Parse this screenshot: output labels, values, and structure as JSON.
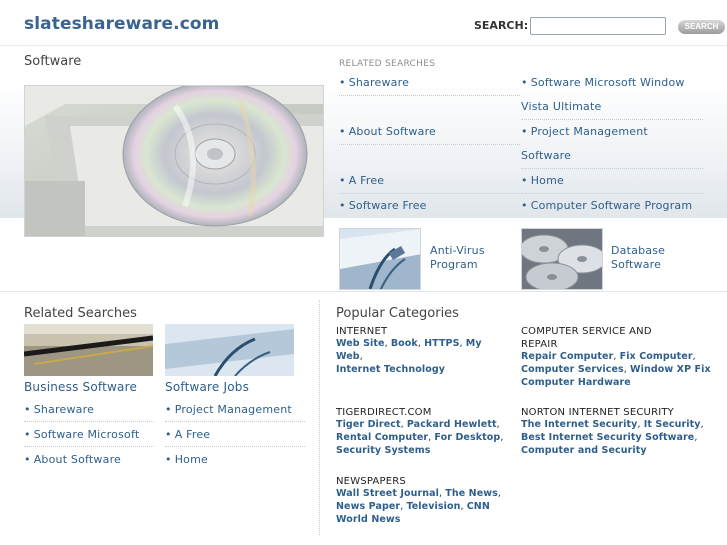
{
  "header": {
    "logo": "slateshareware.com",
    "search_label": "SEARCH:",
    "search_value": "",
    "search_button": "SEARCH"
  },
  "main": {
    "title": "Software"
  },
  "related_searches_top": {
    "title": "RELATED SEARCHES",
    "left": [
      "Shareware",
      "About Software",
      "A Free",
      "Software Free"
    ],
    "right": [
      "Software Microsoft Window Vista Ultimate",
      "Project Management Software",
      "Home",
      "Computer Software Program"
    ],
    "thumbs": [
      {
        "label_line1": "Anti-Virus",
        "label_line2": "Program"
      },
      {
        "label_line1": "Database",
        "label_line2": "Software"
      }
    ]
  },
  "related_searches_bottom": {
    "title": "Related Searches",
    "col1": {
      "heading": "Business Software",
      "links": [
        "Shareware",
        "Software Microsoft",
        "About Software"
      ]
    },
    "col2": {
      "heading": "Software Jobs",
      "links": [
        "Project Management",
        "A Free",
        "Home"
      ]
    }
  },
  "popular": {
    "title": "Popular Categories",
    "categories": [
      {
        "title": "INTERNET",
        "title_line2": "",
        "links": [
          "Web Site",
          "Book",
          "HTTPS",
          "My Web",
          "Internet Technology"
        ]
      },
      {
        "title": "COMPUTER SERVICE AND",
        "title_line2": "REPAIR",
        "links": [
          "Repair Computer",
          "Fix Computer",
          "Computer Services",
          "Window XP Fix",
          "Computer Hardware"
        ]
      },
      {
        "title": "TIGERDIRECT.COM",
        "title_line2": "",
        "links": [
          "Tiger Direct",
          "Packard Hewlett",
          "Rental Computer",
          "For Desktop",
          "Security Systems"
        ]
      },
      {
        "title": "NORTON INTERNET SECURITY",
        "title_line2": "",
        "links": [
          "The Internet Security",
          "It Security",
          "Best Internet Security Software",
          "Computer and Security"
        ]
      },
      {
        "title": "NEWSPAPERS",
        "title_line2": "",
        "links": [
          "Wall Street Journal",
          "The News",
          "News Paper",
          "Television",
          "CNN",
          "World News"
        ]
      }
    ]
  }
}
